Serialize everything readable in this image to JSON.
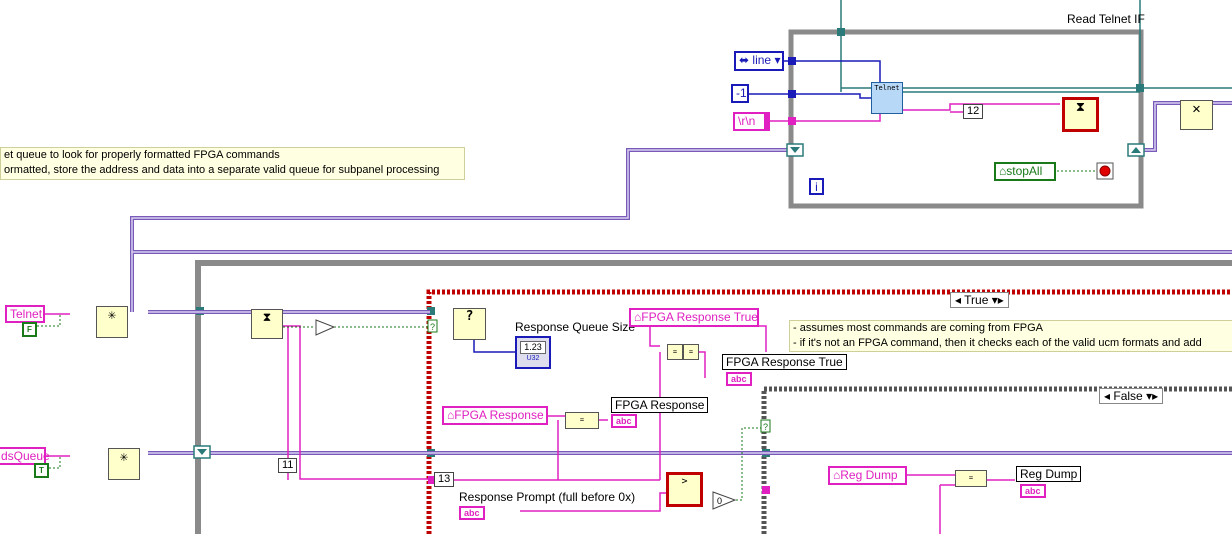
{
  "read_loop": {
    "title": "Read Telnet IF",
    "iteration": "i"
  },
  "inputs": {
    "mode": "line",
    "timeout": "-1",
    "terminator": "\\r\\n"
  },
  "constants": {
    "twelve": "12",
    "eleven": "11",
    "thirteen": "13"
  },
  "controls": {
    "stop_all": "stopAll"
  },
  "comment": {
    "line1": "et queue to look for properly formatted FPGA commands",
    "line2": "ormatted, store the address and data into a separate valid queue for subpanel processing"
  },
  "comment2": {
    "line1": "- assumes most commands are coming from FPGA",
    "line2": "- if it's not an FPGA command, then it checks each of the valid ucm formats and add"
  },
  "left_inputs": {
    "telnet": "Telnet",
    "telnet_bool": "F",
    "queue": "dsQueue",
    "queue_bool": "T"
  },
  "case_main": {
    "selector": "True"
  },
  "case_inner": {
    "selector": "False"
  },
  "labels": {
    "response_queue_size": "Response Queue Size",
    "response_queue_size_value": "1.23",
    "response_queue_size_type": "U32",
    "fpga_response_true": "FPGA Response True",
    "fpga_response": "FPGA Response",
    "response_prompt": "Response Prompt (full before 0x)",
    "reg_dump": "Reg Dump",
    "abc": "abc"
  },
  "icons": {
    "glyph_star": "✳",
    "glyph_hourglass": "⧗",
    "glyph_question": "?",
    "glyph_close": "✕",
    "glyph_eq": "=",
    "glyph_gt": ">",
    "glyph_zero": "0",
    "glyph_telnet": "Telnet"
  }
}
